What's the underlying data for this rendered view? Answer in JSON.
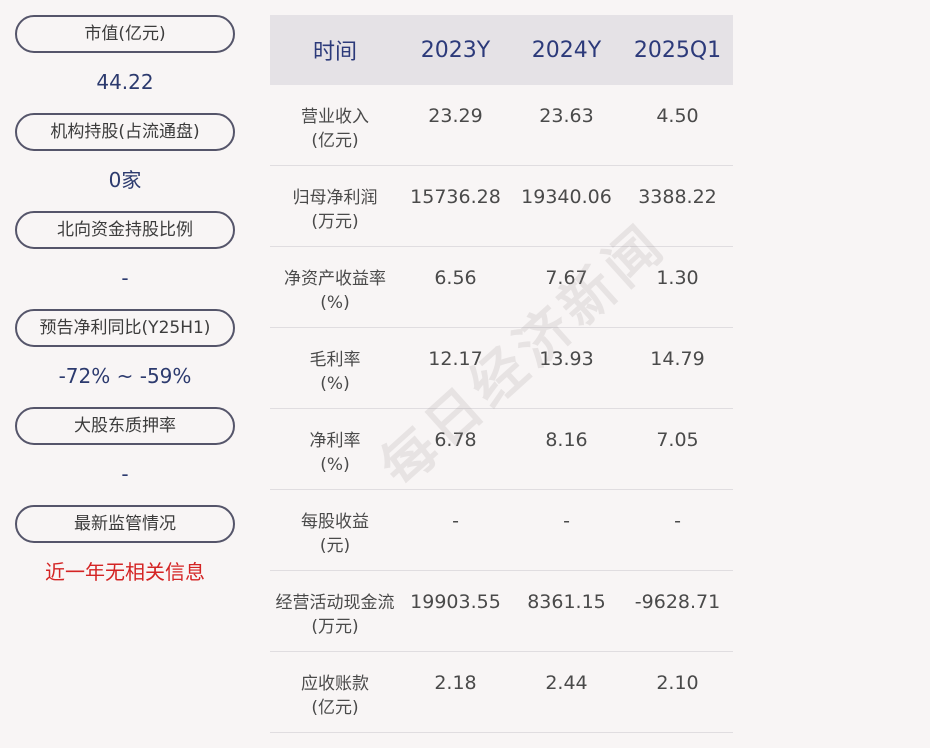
{
  "left": [
    {
      "label": "市值(亿元)",
      "value": "44.22",
      "highlight": false
    },
    {
      "label": "机构持股(占流通盘)",
      "value": "0家",
      "highlight": false
    },
    {
      "label": "北向资金持股比例",
      "value": "-",
      "highlight": false
    },
    {
      "label": "预告净利同比(Y25H1)",
      "value": "-72% ~ -59%",
      "highlight": false
    },
    {
      "label": "大股东质押率",
      "value": "-",
      "highlight": false
    },
    {
      "label": "最新监管情况",
      "value": "近一年无相关信息",
      "highlight": true
    }
  ],
  "table": {
    "headers": [
      "时间",
      "2023Y",
      "2024Y",
      "2025Q1"
    ],
    "rows": [
      {
        "label1": "营业收入",
        "label2": "(亿元)",
        "values": [
          "23.29",
          "23.63",
          "4.50"
        ]
      },
      {
        "label1": "归母净利润",
        "label2": "(万元)",
        "values": [
          "15736.28",
          "19340.06",
          "3388.22"
        ]
      },
      {
        "label1": "净资产收益率",
        "label2": "(%)",
        "values": [
          "6.56",
          "7.67",
          "1.30"
        ]
      },
      {
        "label1": "毛利率",
        "label2": "(%)",
        "values": [
          "12.17",
          "13.93",
          "14.79"
        ]
      },
      {
        "label1": "净利率",
        "label2": "(%)",
        "values": [
          "6.78",
          "8.16",
          "7.05"
        ]
      },
      {
        "label1": "每股收益",
        "label2": "(元)",
        "values": [
          "-",
          "-",
          "-"
        ]
      },
      {
        "label1": "经营活动现金流",
        "label2": "(万元)",
        "values": [
          "19903.55",
          "8361.15",
          "-9628.71"
        ]
      },
      {
        "label1": "应收账款",
        "label2": "(亿元)",
        "values": [
          "2.18",
          "2.44",
          "2.10"
        ]
      }
    ]
  },
  "watermark": "每日经济新闻",
  "colors": {
    "background": "#f8f5f5",
    "header_bg": "#e5e2e6",
    "accent_blue": "#2c3a6e",
    "alert_red": "#d42424"
  }
}
